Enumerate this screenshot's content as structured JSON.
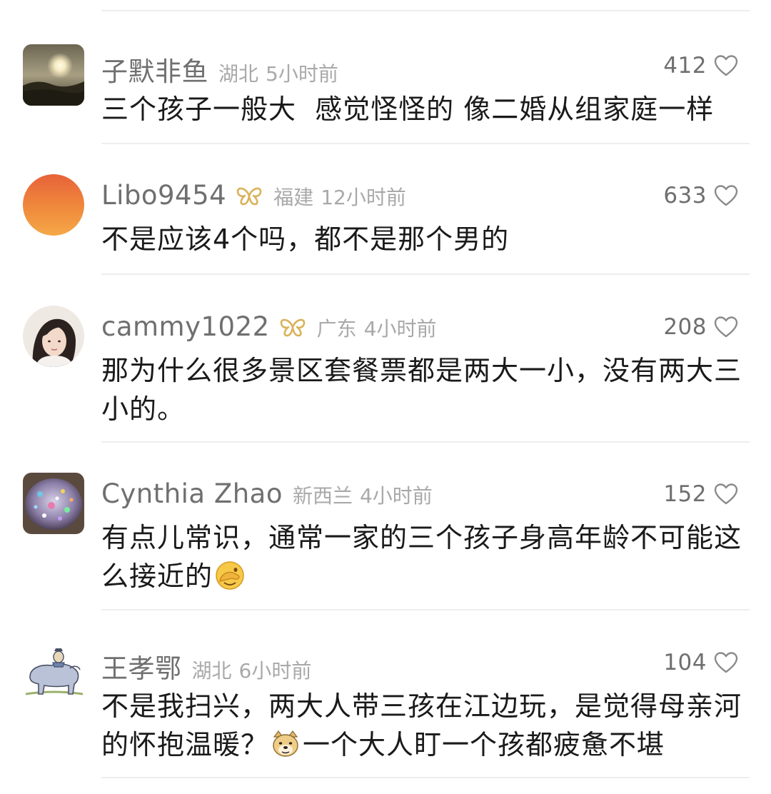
{
  "comments": [
    {
      "username": "子默非鱼",
      "verified_badge": false,
      "location": "湖北",
      "time": "5小时前",
      "likes": "412",
      "text": "三个孩子一般大  感觉怪怪的 像二婚从组家庭一样",
      "avatar_icon": "sunset-landscape-avatar",
      "avatar_shape": "rounded-square"
    },
    {
      "username": "Libo9454",
      "verified_badge": true,
      "location": "福建",
      "time": "12小时前",
      "likes": "633",
      "text": "不是应该4个吗，都不是那个男的",
      "avatar_icon": "orange-gradient-avatar",
      "avatar_shape": "circle"
    },
    {
      "username": "cammy1022",
      "verified_badge": true,
      "location": "广东",
      "time": "4小时前",
      "likes": "208",
      "text": "那为什么很多景区套餐票都是两大一小，没有两大三小的。",
      "avatar_icon": "woman-portrait-avatar",
      "avatar_shape": "circle"
    },
    {
      "username": "Cynthia Zhao",
      "verified_badge": false,
      "location": "新西兰",
      "time": "4小时前",
      "likes": "152",
      "text": "有点儿常识，通常一家的三个孩子身高年龄不可能这么接近的",
      "emoji_icon": "facepalm-emoji",
      "avatar_icon": "sparkle-bowl-avatar",
      "avatar_shape": "rounded-square"
    },
    {
      "username": "王孝鄂",
      "verified_badge": false,
      "location": "湖北",
      "time": "6小时前",
      "likes": "104",
      "text_before_emoji": "不是我扫兴，两大人带三孩在江边玩，是觉得母亲河的怀抱温暖？",
      "text_after_emoji": "一个大人盯一个孩都疲惫不堪",
      "emoji_icon": "doge-emoji",
      "avatar_icon": "ox-sketch-avatar",
      "avatar_shape": "rounded-square"
    }
  ],
  "colors": {
    "username": "#6f6f6f",
    "meta": "#a9a9a9",
    "text": "#1a1a1a",
    "badge": "#d9b25a",
    "divider": "#ededed"
  },
  "icons": {
    "like": "heart-outline-icon",
    "verified": "butterfly-badge-icon"
  }
}
